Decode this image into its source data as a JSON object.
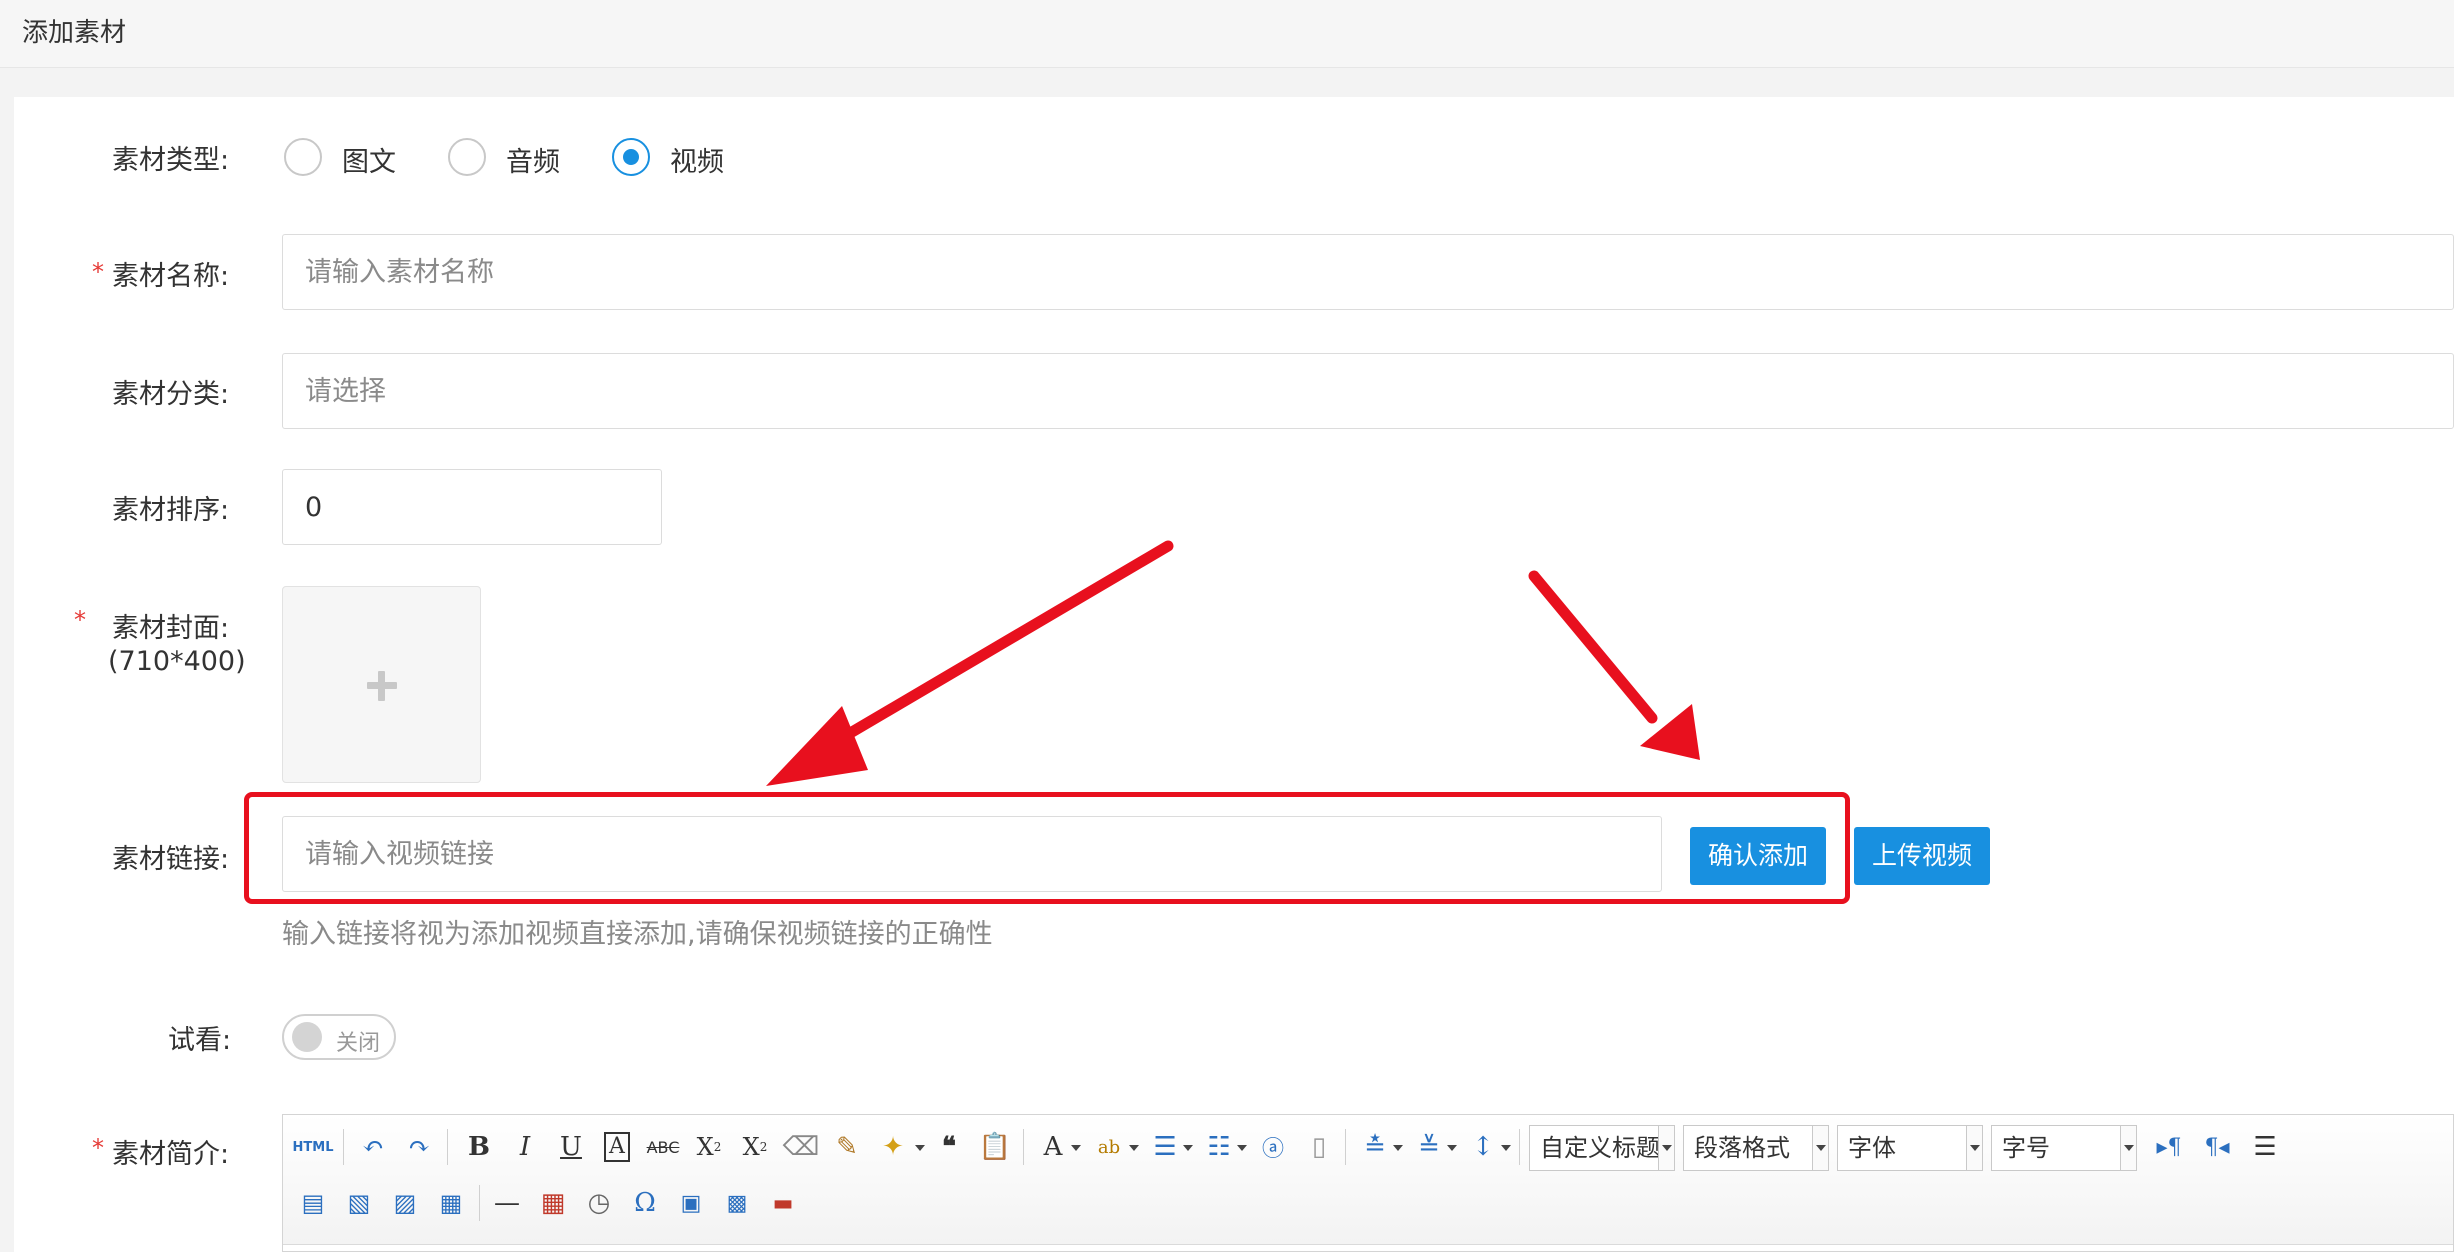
{
  "header": {
    "title": "添加素材"
  },
  "form": {
    "type": {
      "label": "素材类型:",
      "options": [
        "图文",
        "音频",
        "视频"
      ],
      "selected": "视频"
    },
    "name": {
      "label": "素材名称:",
      "required_mark": "*",
      "placeholder": "请输入素材名称"
    },
    "category": {
      "label": "素材分类:",
      "placeholder": "请选择"
    },
    "sort": {
      "label": "素材排序:",
      "value": "0"
    },
    "cover": {
      "label": "素材封面:",
      "size_note": "(710*400)",
      "required_mark": "*"
    },
    "link": {
      "label": "素材链接:",
      "placeholder": "请输入视频链接",
      "confirm_button": "确认添加",
      "upload_button": "上传视频",
      "hint": "输入链接将视为添加视频直接添加,请确保视频链接的正确性"
    },
    "preview": {
      "label": "试看:",
      "switch_text": "关闭",
      "enabled": false
    },
    "intro": {
      "label": "素材简介:",
      "required_mark": "*",
      "toolbar": {
        "html_label": "HTML",
        "custom_heading": "自定义标题",
        "paragraph_format": "段落格式",
        "font_family": "字体",
        "font_size": "字号"
      }
    }
  },
  "colors": {
    "primary": "#1890e0",
    "annotation_red": "#e8101e",
    "required": "#e53935"
  }
}
